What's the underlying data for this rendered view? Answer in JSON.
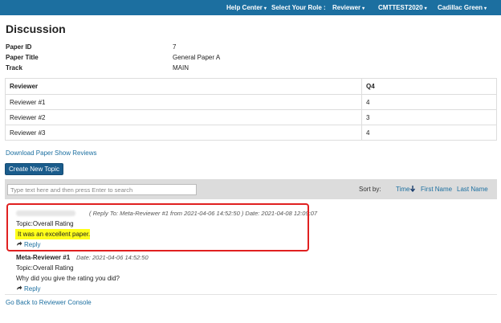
{
  "nav": {
    "help_center": "Help Center",
    "select_role_label": "Select Your Role :",
    "role": "Reviewer",
    "conference": "CMTTEST2020",
    "user": "Cadillac Green"
  },
  "page": {
    "title": "Discussion"
  },
  "paper": {
    "id_label": "Paper ID",
    "id_value": "7",
    "title_label": "Paper Title",
    "title_value": "General Paper A",
    "track_label": "Track",
    "track_value": "MAIN"
  },
  "reviews_table": {
    "headers": [
      "Reviewer",
      "Q4"
    ],
    "rows": [
      [
        "Reviewer #1",
        "4"
      ],
      [
        "Reviewer #2",
        "3"
      ],
      [
        "Reviewer #3",
        "4"
      ]
    ]
  },
  "links": {
    "download_paper": "Download Paper",
    "show_reviews": "Show Reviews",
    "back": "Go Back to Reviewer Console"
  },
  "create_topic_button": "Create New Topic",
  "search": {
    "placeholder": "Type text here and then press Enter to search"
  },
  "sort": {
    "label": "Sort by:",
    "time": "Time",
    "first_name": "First Name",
    "last_name": "Last Name"
  },
  "posts": [
    {
      "meta": "( Reply To: Meta-Reviewer #1 from 2021-04-06 14:52:50 ) Date: 2021-04-08 12:09:07",
      "topic": "Topic:Overall Rating",
      "body": "It was an excellent paper.",
      "reply": "Reply"
    },
    {
      "author": "Meta-Reviewer #1",
      "meta": "Date: 2021-04-06 14:52:50",
      "topic": "Topic:Overall Rating",
      "body": "Why did you give the rating you did?",
      "reply": "Reply"
    }
  ],
  "colors": {
    "nav_bg": "#1c6fa0",
    "button_bg": "#1a5c8c",
    "highlight": "#ffff1a",
    "annotation_border": "#e02020"
  }
}
